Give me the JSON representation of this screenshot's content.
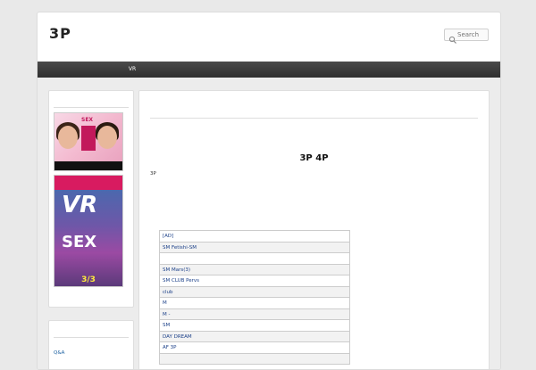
{
  "header": {
    "site_title": "3P",
    "tagline": "",
    "search_placeholder": "Search"
  },
  "nav": {
    "items": [
      {
        "label": ""
      },
      {
        "label": ""
      },
      {
        "label": "VR"
      },
      {
        "label": ""
      },
      {
        "label": ""
      },
      {
        "label": ""
      },
      {
        "label": ""
      }
    ]
  },
  "sidebar": {
    "widget1_title": "",
    "banner1_text": "SEX",
    "banner2_top": "",
    "banner2_vr": "VR",
    "banner2_sex": "SEX",
    "banner2_date": "3/3",
    "widget2_title": "",
    "links": [
      {
        "label": ""
      },
      {
        "label": "Q&A"
      }
    ]
  },
  "main": {
    "title": "",
    "headline": "3P  4P",
    "paragraph": "3P",
    "link_line": "",
    "table_caption": "",
    "rows": [
      {
        "label": "[AD]"
      },
      {
        "label": "SM  Fetishi-SM"
      },
      {
        "label": ""
      },
      {
        "label": "SM  Mars(3)"
      },
      {
        "label": "SM  CLUB Pervs"
      },
      {
        "label": "club"
      },
      {
        "label": "M"
      },
      {
        "label": "M  -"
      },
      {
        "label": "SM"
      },
      {
        "label": "DAY DREAM"
      },
      {
        "label": "AF  3P"
      },
      {
        "label": ""
      }
    ]
  }
}
